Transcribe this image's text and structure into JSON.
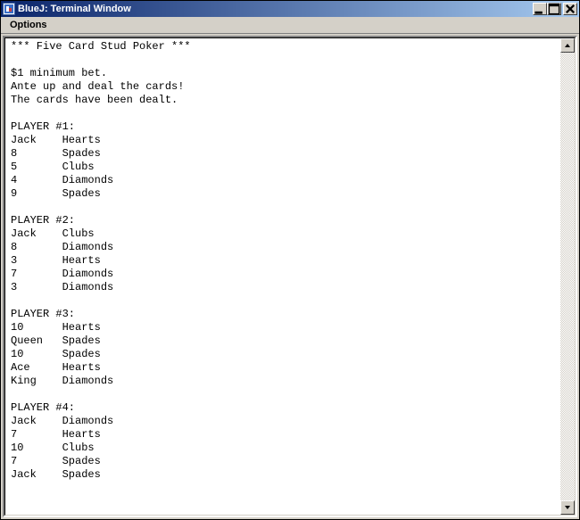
{
  "window": {
    "title": "BlueJ:  Terminal Window"
  },
  "menu": {
    "options_label": "Options"
  },
  "terminal": {
    "header": "*** Five Card Stud Poker ***",
    "lines_intro": [
      "$1 minimum bet.",
      "Ante up and deal the cards!",
      "The cards have been dealt."
    ],
    "players": [
      {
        "label": "PLAYER #1:",
        "cards": [
          {
            "rank": "Jack",
            "suit": "Hearts"
          },
          {
            "rank": "8",
            "suit": "Spades"
          },
          {
            "rank": "5",
            "suit": "Clubs"
          },
          {
            "rank": "4",
            "suit": "Diamonds"
          },
          {
            "rank": "9",
            "suit": "Spades"
          }
        ]
      },
      {
        "label": "PLAYER #2:",
        "cards": [
          {
            "rank": "Jack",
            "suit": "Clubs"
          },
          {
            "rank": "8",
            "suit": "Diamonds"
          },
          {
            "rank": "3",
            "suit": "Hearts"
          },
          {
            "rank": "7",
            "suit": "Diamonds"
          },
          {
            "rank": "3",
            "suit": "Diamonds"
          }
        ]
      },
      {
        "label": "PLAYER #3:",
        "cards": [
          {
            "rank": "10",
            "suit": "Hearts"
          },
          {
            "rank": "Queen",
            "suit": "Spades"
          },
          {
            "rank": "10",
            "suit": "Spades"
          },
          {
            "rank": "Ace",
            "suit": "Hearts"
          },
          {
            "rank": "King",
            "suit": "Diamonds"
          }
        ]
      },
      {
        "label": "PLAYER #4:",
        "cards": [
          {
            "rank": "Jack",
            "suit": "Diamonds"
          },
          {
            "rank": "7",
            "suit": "Hearts"
          },
          {
            "rank": "10",
            "suit": "Clubs"
          },
          {
            "rank": "7",
            "suit": "Spades"
          },
          {
            "rank": "Jack",
            "suit": "Spades"
          }
        ]
      }
    ]
  }
}
